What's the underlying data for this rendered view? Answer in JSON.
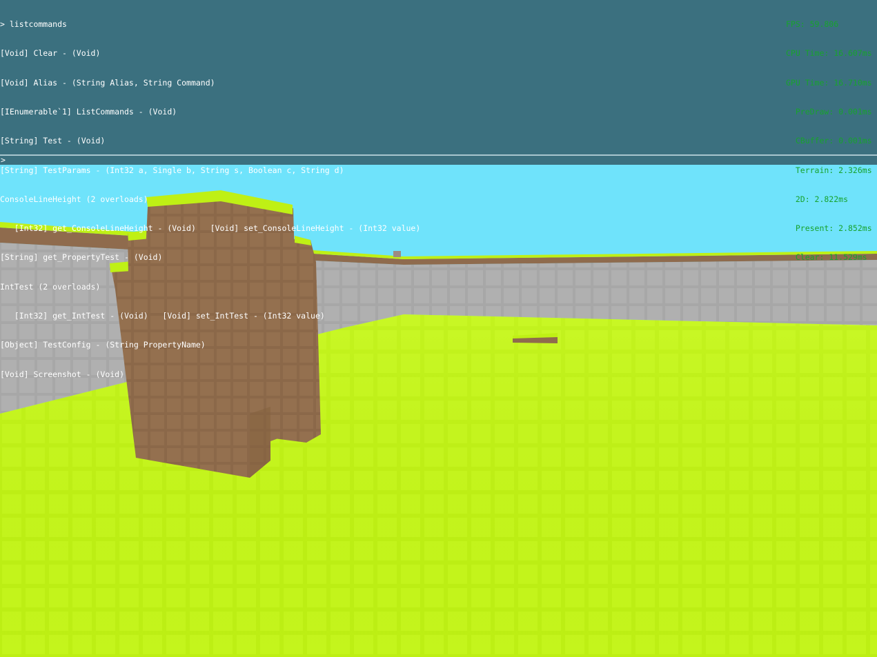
{
  "console": {
    "lines": [
      "> listcommands",
      "[Void] Clear - (Void)",
      "[Void] Alias - (String Alias, String Command)",
      "[IEnumerable`1] ListCommands - (Void)",
      "[String] Test - (Void)",
      "[String] TestParams - (Int32 a, Single b, String s, Boolean c, String d)",
      "ConsoleLineHeight (2 overloads)",
      "   [Int32] get_ConsoleLineHeight - (Void)   [Void] set_ConsoleLineHeight - (Int32 value)",
      "[String] get_PropertyTest - (Void)",
      "IntTest (2 overloads)",
      "   [Int32] get_IntTest - (Void)   [Void] set_IntTest - (Int32 value)",
      "[Object] TestConfig - (String PropertyName)",
      "[Void] Screenshot - (Void)"
    ],
    "prompt": ">",
    "input_value": "",
    "background_color": "#3b707f",
    "text_color": "#ffffff"
  },
  "stats": {
    "lines": [
      "FPS: 59.806",
      "CPU Time: 16.607ms",
      "GPU Time: 16.710ms",
      "  PreDraw: 0.001ms",
      "  CBuffer: 0.001ms",
      "  Terrain: 2.326ms",
      "  2D: 2.822ms",
      "  Present: 2.852ms",
      "  Clear: 11.529ms"
    ],
    "text_color": "#17a32d"
  },
  "scene": {
    "sky_color": "#6fe3fb",
    "grass_color": "#bff015",
    "dirt_color": "#8f6b4d",
    "stone_color": "#a8a8a8"
  }
}
